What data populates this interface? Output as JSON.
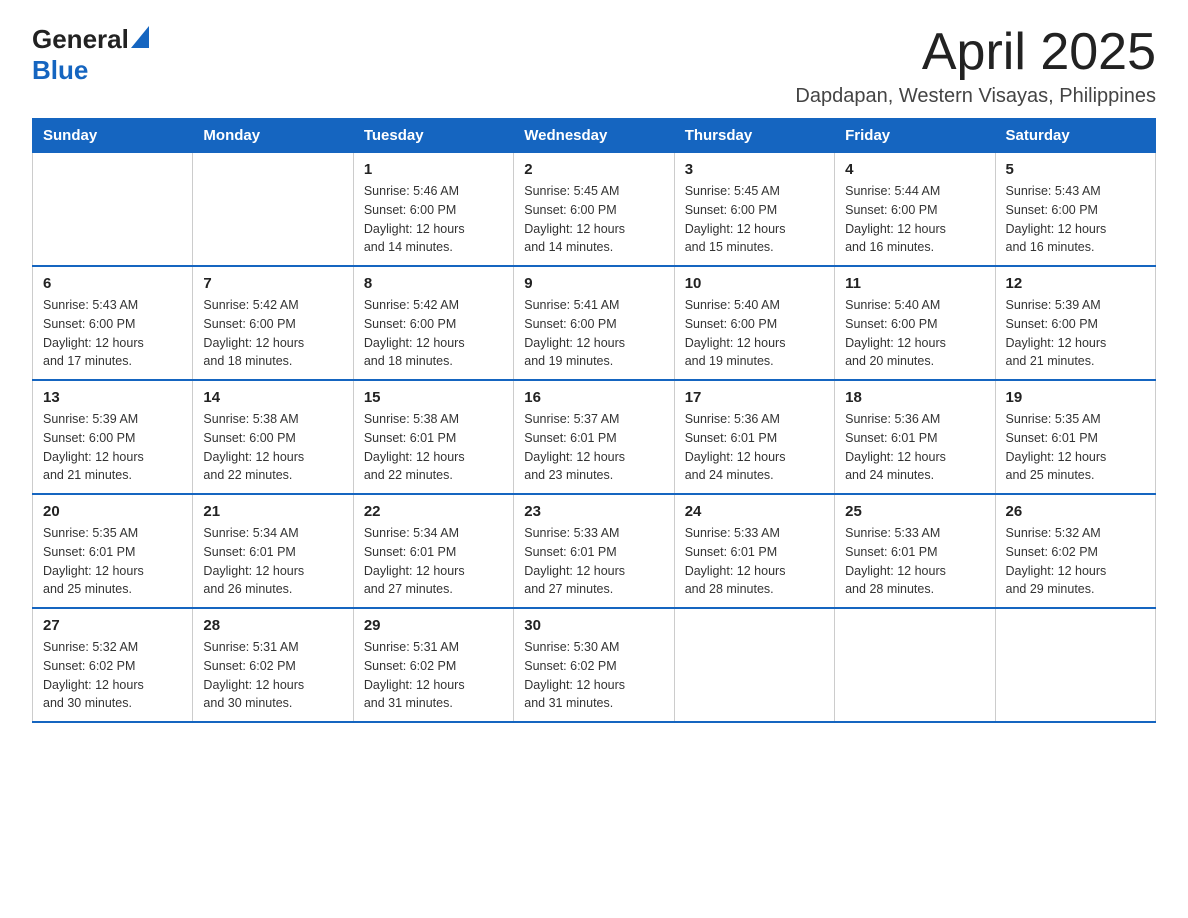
{
  "header": {
    "logo_general": "General",
    "logo_blue": "Blue",
    "month_title": "April 2025",
    "location": "Dapdapan, Western Visayas, Philippines"
  },
  "calendar": {
    "days_of_week": [
      "Sunday",
      "Monday",
      "Tuesday",
      "Wednesday",
      "Thursday",
      "Friday",
      "Saturday"
    ],
    "weeks": [
      [
        {
          "day": "",
          "info": ""
        },
        {
          "day": "",
          "info": ""
        },
        {
          "day": "1",
          "info": "Sunrise: 5:46 AM\nSunset: 6:00 PM\nDaylight: 12 hours\nand 14 minutes."
        },
        {
          "day": "2",
          "info": "Sunrise: 5:45 AM\nSunset: 6:00 PM\nDaylight: 12 hours\nand 14 minutes."
        },
        {
          "day": "3",
          "info": "Sunrise: 5:45 AM\nSunset: 6:00 PM\nDaylight: 12 hours\nand 15 minutes."
        },
        {
          "day": "4",
          "info": "Sunrise: 5:44 AM\nSunset: 6:00 PM\nDaylight: 12 hours\nand 16 minutes."
        },
        {
          "day": "5",
          "info": "Sunrise: 5:43 AM\nSunset: 6:00 PM\nDaylight: 12 hours\nand 16 minutes."
        }
      ],
      [
        {
          "day": "6",
          "info": "Sunrise: 5:43 AM\nSunset: 6:00 PM\nDaylight: 12 hours\nand 17 minutes."
        },
        {
          "day": "7",
          "info": "Sunrise: 5:42 AM\nSunset: 6:00 PM\nDaylight: 12 hours\nand 18 minutes."
        },
        {
          "day": "8",
          "info": "Sunrise: 5:42 AM\nSunset: 6:00 PM\nDaylight: 12 hours\nand 18 minutes."
        },
        {
          "day": "9",
          "info": "Sunrise: 5:41 AM\nSunset: 6:00 PM\nDaylight: 12 hours\nand 19 minutes."
        },
        {
          "day": "10",
          "info": "Sunrise: 5:40 AM\nSunset: 6:00 PM\nDaylight: 12 hours\nand 19 minutes."
        },
        {
          "day": "11",
          "info": "Sunrise: 5:40 AM\nSunset: 6:00 PM\nDaylight: 12 hours\nand 20 minutes."
        },
        {
          "day": "12",
          "info": "Sunrise: 5:39 AM\nSunset: 6:00 PM\nDaylight: 12 hours\nand 21 minutes."
        }
      ],
      [
        {
          "day": "13",
          "info": "Sunrise: 5:39 AM\nSunset: 6:00 PM\nDaylight: 12 hours\nand 21 minutes."
        },
        {
          "day": "14",
          "info": "Sunrise: 5:38 AM\nSunset: 6:00 PM\nDaylight: 12 hours\nand 22 minutes."
        },
        {
          "day": "15",
          "info": "Sunrise: 5:38 AM\nSunset: 6:01 PM\nDaylight: 12 hours\nand 22 minutes."
        },
        {
          "day": "16",
          "info": "Sunrise: 5:37 AM\nSunset: 6:01 PM\nDaylight: 12 hours\nand 23 minutes."
        },
        {
          "day": "17",
          "info": "Sunrise: 5:36 AM\nSunset: 6:01 PM\nDaylight: 12 hours\nand 24 minutes."
        },
        {
          "day": "18",
          "info": "Sunrise: 5:36 AM\nSunset: 6:01 PM\nDaylight: 12 hours\nand 24 minutes."
        },
        {
          "day": "19",
          "info": "Sunrise: 5:35 AM\nSunset: 6:01 PM\nDaylight: 12 hours\nand 25 minutes."
        }
      ],
      [
        {
          "day": "20",
          "info": "Sunrise: 5:35 AM\nSunset: 6:01 PM\nDaylight: 12 hours\nand 25 minutes."
        },
        {
          "day": "21",
          "info": "Sunrise: 5:34 AM\nSunset: 6:01 PM\nDaylight: 12 hours\nand 26 minutes."
        },
        {
          "day": "22",
          "info": "Sunrise: 5:34 AM\nSunset: 6:01 PM\nDaylight: 12 hours\nand 27 minutes."
        },
        {
          "day": "23",
          "info": "Sunrise: 5:33 AM\nSunset: 6:01 PM\nDaylight: 12 hours\nand 27 minutes."
        },
        {
          "day": "24",
          "info": "Sunrise: 5:33 AM\nSunset: 6:01 PM\nDaylight: 12 hours\nand 28 minutes."
        },
        {
          "day": "25",
          "info": "Sunrise: 5:33 AM\nSunset: 6:01 PM\nDaylight: 12 hours\nand 28 minutes."
        },
        {
          "day": "26",
          "info": "Sunrise: 5:32 AM\nSunset: 6:02 PM\nDaylight: 12 hours\nand 29 minutes."
        }
      ],
      [
        {
          "day": "27",
          "info": "Sunrise: 5:32 AM\nSunset: 6:02 PM\nDaylight: 12 hours\nand 30 minutes."
        },
        {
          "day": "28",
          "info": "Sunrise: 5:31 AM\nSunset: 6:02 PM\nDaylight: 12 hours\nand 30 minutes."
        },
        {
          "day": "29",
          "info": "Sunrise: 5:31 AM\nSunset: 6:02 PM\nDaylight: 12 hours\nand 31 minutes."
        },
        {
          "day": "30",
          "info": "Sunrise: 5:30 AM\nSunset: 6:02 PM\nDaylight: 12 hours\nand 31 minutes."
        },
        {
          "day": "",
          "info": ""
        },
        {
          "day": "",
          "info": ""
        },
        {
          "day": "",
          "info": ""
        }
      ]
    ]
  }
}
